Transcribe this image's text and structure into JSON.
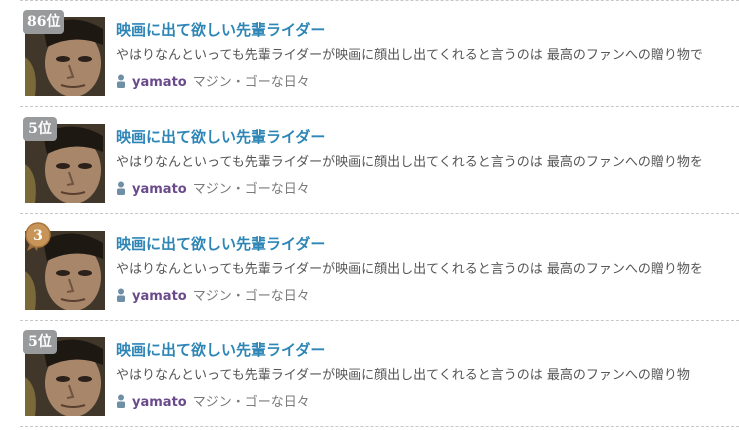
{
  "entries": [
    {
      "rank": "86位",
      "title": "映画に出て欲しい先輩ライダー",
      "excerpt": "やはりなんといっても先輩ライダーが映画に顔出し出てくれると言うのは 最高のファンへの贈り物で",
      "author": "yamato",
      "blog": "マジン・ゴーな日々"
    },
    {
      "rank": "5位",
      "title": "映画に出て欲しい先輩ライダー",
      "excerpt": "やはりなんといっても先輩ライダーが映画に顔出し出てくれると言うのは 最高のファンへの贈り物を",
      "author": "yamato",
      "blog": "マジン・ゴーな日々"
    },
    {
      "rank": "3",
      "title": "映画に出て欲しい先輩ライダー",
      "excerpt": "やはりなんといっても先輩ライダーが映画に顔出し出てくれると言うのは 最高のファンへの贈り物を",
      "author": "yamato",
      "blog": "マジン・ゴーな日々"
    },
    {
      "rank": "5位",
      "title": "映画に出て欲しい先輩ライダー",
      "excerpt": "やはりなんといっても先輩ライダーが映画に顔出し出てくれると言うのは 最高のファンへの贈り物",
      "author": "yamato",
      "blog": "マジン・ゴーな日々"
    }
  ],
  "icons": {
    "author": "user-icon",
    "medal": "bronze-medal-icon"
  },
  "colors": {
    "title": "#2e86b6",
    "author": "#6a4a8a",
    "rank_badge": "#999a9c",
    "medal": "#c89458"
  }
}
